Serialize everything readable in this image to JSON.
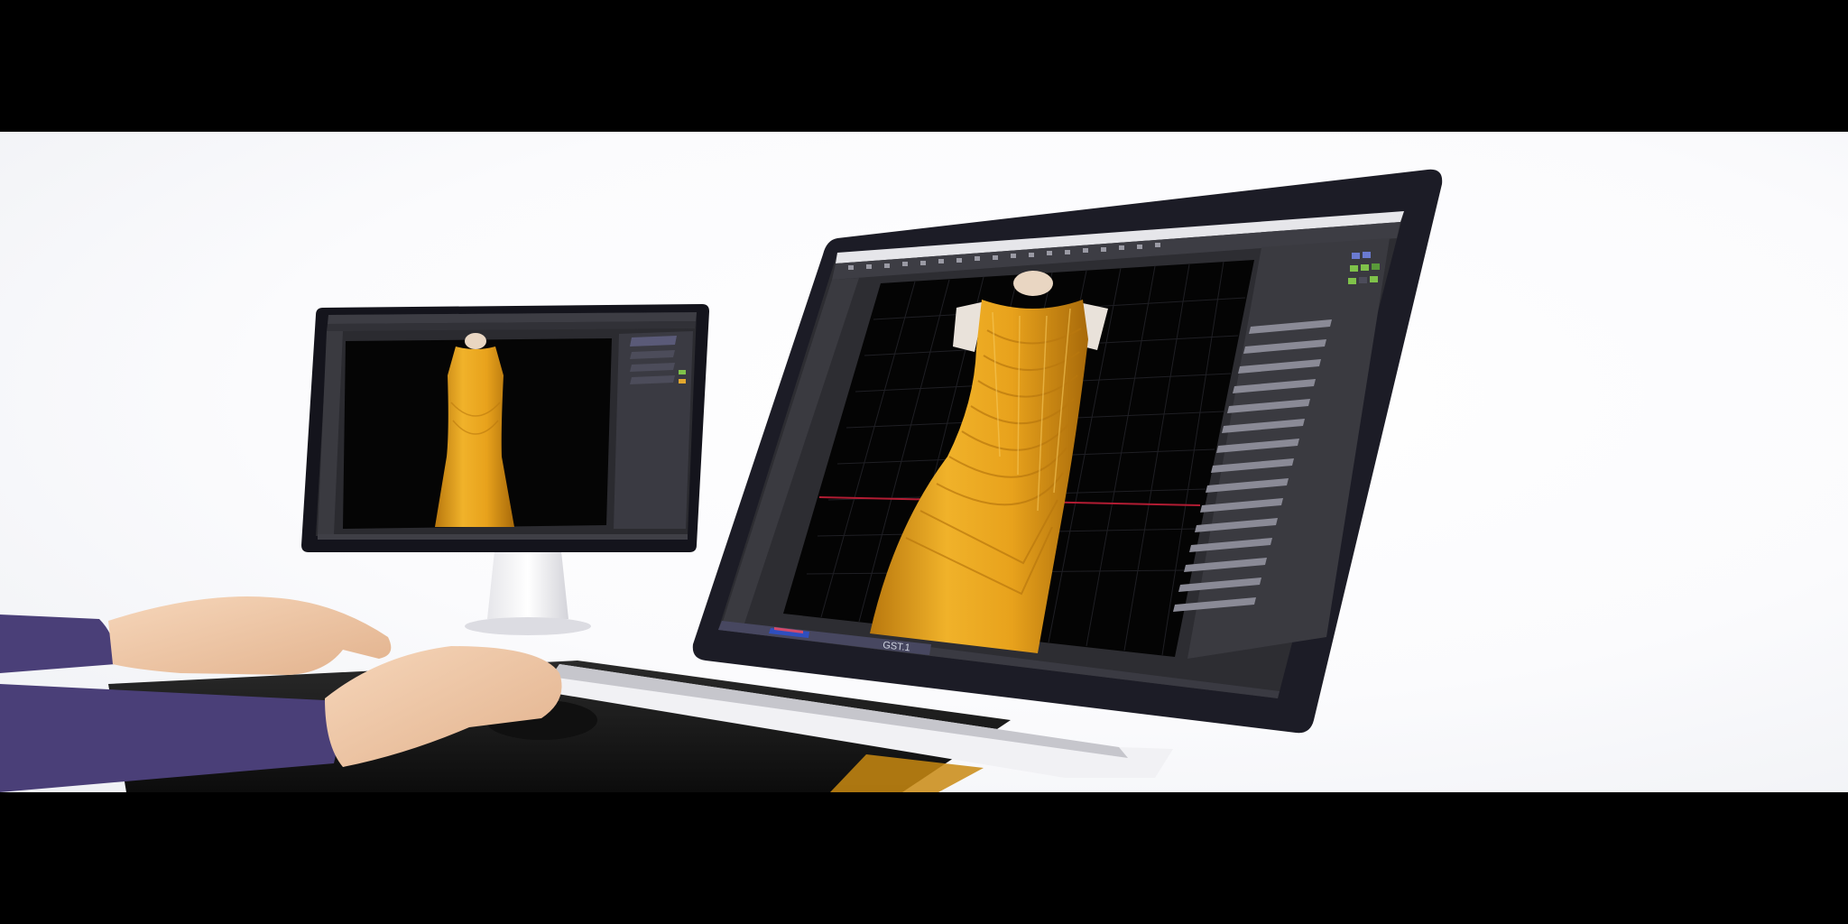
{
  "photo": {
    "subject": "fashion-design-workstation",
    "colors": {
      "dress": "#E8A21C",
      "dress_shadow": "#B9780E",
      "viewport": "#050505",
      "panel": "#3a3a3e",
      "panel_dark": "#2a2a2e",
      "bezel": "#1c1c26",
      "sleeve": "#4a3f78",
      "skin": "#f1c9a8",
      "desk": "#151515"
    }
  },
  "large_monitor": {
    "status_text": "GST.1"
  }
}
